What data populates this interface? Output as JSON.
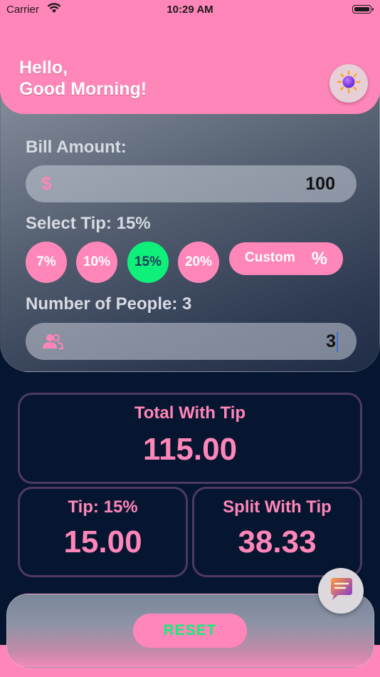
{
  "status_bar": {
    "carrier": "Carrier",
    "time": "10:29 AM"
  },
  "header": {
    "greeting_line1": "Hello,",
    "greeting_line2": "Good Morning!",
    "theme_icon": "sun-icon"
  },
  "bill": {
    "label": "Bill Amount:",
    "currency_symbol": "$",
    "value": "100"
  },
  "tip": {
    "label": "Select Tip: 15%",
    "options": [
      "7%",
      "10%",
      "15%",
      "20%"
    ],
    "selected": "15%",
    "custom_label": "Custom",
    "custom_symbol": "%"
  },
  "people": {
    "label": "Number of People: 3",
    "icon": "people-icon",
    "value": "3"
  },
  "results": {
    "total_title": "Total With Tip",
    "total_value": "115.00",
    "tip_title": "Tip: 15%",
    "tip_value": "15.00",
    "split_title": "Split With Tip",
    "split_value": "38.33"
  },
  "chat_icon": "chat-bubble-icon",
  "reset_label": "RESET",
  "colors": {
    "accent_pink": "#ff86b8",
    "selected_green": "#0ff07a",
    "background": "#071630"
  }
}
